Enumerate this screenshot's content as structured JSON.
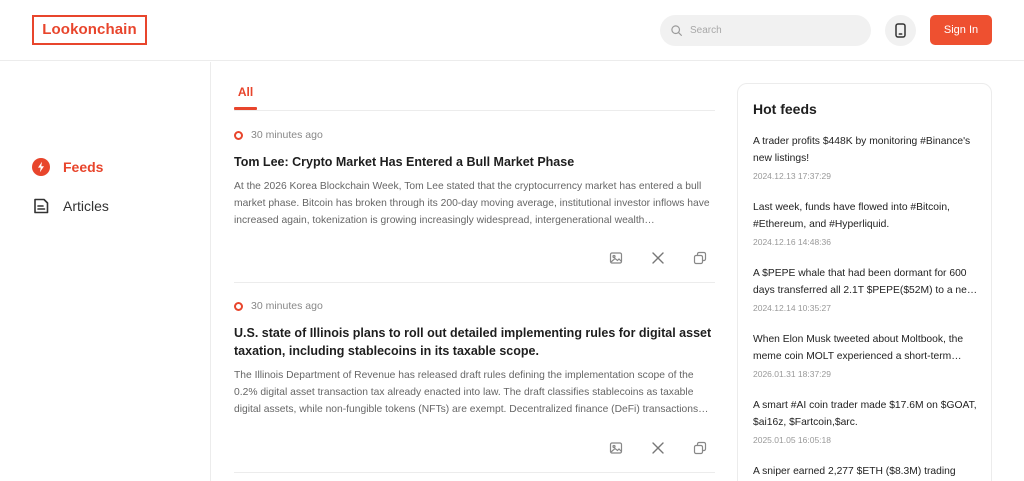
{
  "header": {
    "logo": "Lookonchain",
    "search_placeholder": "Search",
    "sign_in": "Sign In"
  },
  "nav": {
    "items": [
      {
        "label": "Feeds",
        "icon": "bolt-icon",
        "active": true
      },
      {
        "label": "Articles",
        "icon": "document-icon",
        "active": false
      }
    ]
  },
  "tabs": [
    {
      "label": "All",
      "active": true
    }
  ],
  "feeds": [
    {
      "time": "30 minutes ago",
      "title": "Tom Lee: Crypto Market Has Entered a Bull Market Phase",
      "body": "At the 2026 Korea Blockchain Week, Tom Lee stated that the cryptocurrency market has entered a bull market phase. Bitcoin has broken through its 200-day moving average, institutional investor inflows have increased again, tokenization is growing increasingly widespread, intergenerational wealth…"
    },
    {
      "time": "30 minutes ago",
      "title": "U.S. state of Illinois plans to roll out detailed implementing rules for digital asset taxation, including stablecoins in its taxable scope.",
      "body": "The Illinois Department of Revenue has released draft rules defining the implementation scope of the 0.2% digital asset transaction tax already enacted into law. The draft classifies stablecoins as taxable digital assets, while non-fungible tokens (NFTs) are exempt. Decentralized finance (DeFi) transactions…"
    }
  ],
  "hot": {
    "title": "Hot feeds",
    "items": [
      {
        "text": "A trader profits $448K by monitoring #Binance's new listings!",
        "date": "2024.12.13 17:37:29"
      },
      {
        "text": "Last week, funds have flowed into #Bitcoin, #Ethereum, and #Hyperliquid.",
        "date": "2024.12.16 14:48:36"
      },
      {
        "text": "A $PEPE whale that had been dormant for 600 days transferred all 2.1T $PEPE($52M) to a ne…",
        "date": "2024.12.14 10:35:27"
      },
      {
        "text": "When Elon Musk tweeted about Moltbook, the meme coin MOLT experienced a short-term…",
        "date": "2026.01.31 18:37:29"
      },
      {
        "text": "A smart #AI coin trader made $17.6M on $GOAT, $ai16z, $Fartcoin,$arc.",
        "date": "2025.01.05 16:05:18"
      },
      {
        "text": "A sniper earned 2,277 $ETH ($8.3M) trading",
        "date": ""
      }
    ]
  },
  "colors": {
    "accent": "#e8452c",
    "button": "#ee5030"
  }
}
